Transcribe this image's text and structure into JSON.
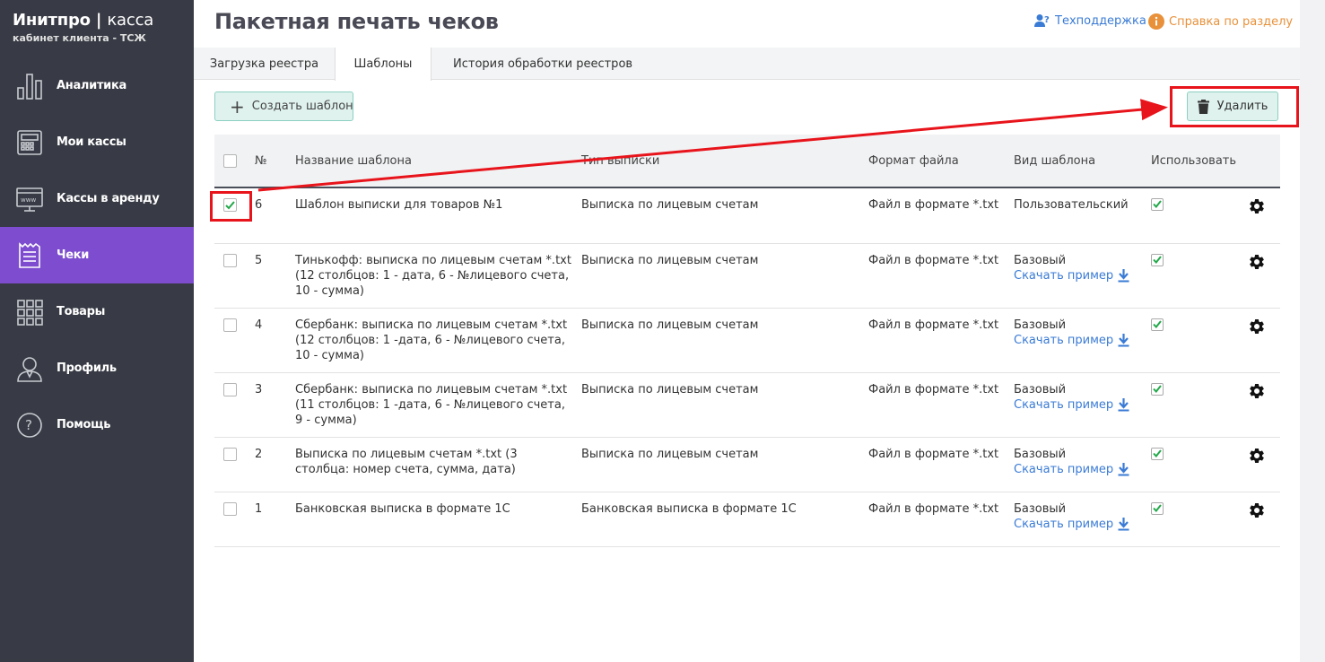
{
  "brand": {
    "title_bold": "Инитпро",
    "separator": "|",
    "title_light": "касса",
    "subtitle": "кабинет клиента - ТСЖ"
  },
  "sidebar": {
    "items": [
      {
        "label": "Аналитика",
        "icon": "analytics-icon"
      },
      {
        "label": "Мои кассы",
        "icon": "cash-register-icon"
      },
      {
        "label": "Кассы в аренду",
        "icon": "www-monitor-icon"
      },
      {
        "label": "Чеки",
        "icon": "receipt-icon",
        "active": true
      },
      {
        "label": "Товары",
        "icon": "grid-icon"
      },
      {
        "label": "Профиль",
        "icon": "user-icon"
      },
      {
        "label": "Помощь",
        "icon": "help-circle-icon"
      }
    ]
  },
  "header": {
    "title": "Пакетная печать чеков",
    "support": "Техподдержка",
    "help": "Справка по разделу"
  },
  "tabs": [
    "Загрузка реестра",
    "Шаблоны",
    "История обработки реестров"
  ],
  "toolbar": {
    "create": "Создать шаблон",
    "delete": "Удалить"
  },
  "table": {
    "headers": {
      "num": "№",
      "name": "Название шаблона",
      "type": "Тип выписки",
      "format": "Формат файла",
      "kind": "Вид шаблона",
      "use": "Использовать"
    },
    "rows": [
      {
        "checked": true,
        "num": "6",
        "name": "Шаблон выписки для товаров №1",
        "type": "Выписка по лицевым счетам",
        "format": "Файл в формате *.txt",
        "kind": "Пользовательский",
        "download": ""
      },
      {
        "checked": false,
        "num": "5",
        "name": "Тинькофф: выписка по лицевым счетам *.txt (12 столбцов: 1 - дата, 6 - №лицевого счета, 10 - сумма)",
        "type": "Выписка по лицевым счетам",
        "format": "Файл в формате *.txt",
        "kind": "Базовый",
        "download": "Скачать пример"
      },
      {
        "checked": false,
        "num": "4",
        "name": "Сбербанк: выписка по лицевым счетам *.txt (12 столбцов: 1 -дата, 6 - №лицевого счета, 10 - сумма)",
        "type": "Выписка по лицевым счетам",
        "format": "Файл в формате *.txt",
        "kind": "Базовый",
        "download": "Скачать пример"
      },
      {
        "checked": false,
        "num": "3",
        "name": "Сбербанк: выписка по лицевым счетам *.txt (11 столбцов: 1 -дата, 6 - №лицевого счета, 9 - сумма)",
        "type": "Выписка по лицевым счетам",
        "format": "Файл в формате *.txt",
        "kind": "Базовый",
        "download": "Скачать пример"
      },
      {
        "checked": false,
        "num": "2",
        "name": "Выписка по лицевым счетам *.txt (3 столбца: номер счета, сумма, дата)",
        "type": "Выписка по лицевым счетам",
        "format": "Файл в формате *.txt",
        "kind": "Базовый",
        "download": "Скачать пример"
      },
      {
        "checked": false,
        "num": "1",
        "name": "Банковская выписка в формате 1С",
        "type": "Банковская выписка в формате 1С",
        "format": "Файл в формате *.txt",
        "kind": "Базовый",
        "download": "Скачать пример"
      }
    ]
  },
  "colors": {
    "sidebar": "#383b45",
    "active": "#7d4ccf",
    "accent": "#3a7bd5",
    "help": "#e8913a",
    "annotation": "#e8141b",
    "check": "#22a84a"
  }
}
